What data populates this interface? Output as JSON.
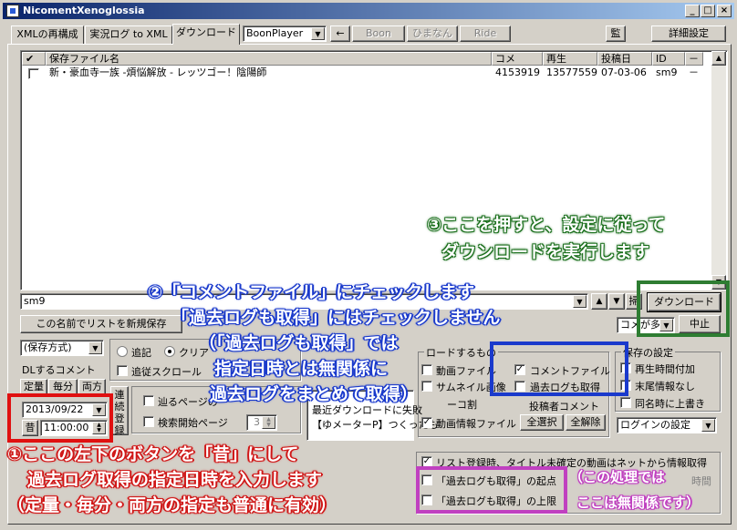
{
  "window": {
    "title": "NicomentXenoglossia",
    "minimize": "_",
    "maximize": "□",
    "close": "×"
  },
  "tabs": [
    {
      "label": "XMLの再構成"
    },
    {
      "label": "実況ログ to XML"
    },
    {
      "label": "ダウンロード"
    }
  ],
  "toolbar": {
    "player_select": "BoonPlayer",
    "back_arrow": "←",
    "boon": "Boon",
    "himanan": "ひまなん",
    "ride": "Ride",
    "kan": "監",
    "settings": "詳細設定"
  },
  "table": {
    "columns": [
      "✔",
      "保存ファイル名",
      "コメ",
      "再生",
      "投稿日",
      "ID",
      "－"
    ],
    "rows": [
      {
        "checked": "",
        "name": "新・豪血寺一族 -煩悩解放 - レッツゴー！陰陽師",
        "comments": "4153919",
        "views": "13577559",
        "date": "07-03-06",
        "id": "sm9",
        "dash": "－"
      }
    ]
  },
  "search": {
    "value": "sm9",
    "up": "▲",
    "down": "▼",
    "small_btn": "掃",
    "download_btn": "ダウンロード",
    "stop_btn": "中止",
    "new_list_btn": "この名前でリストを新規保存",
    "sort_combo": "コメが多い"
  },
  "save_method": {
    "combo": "(保存方式)",
    "dl_comment_label": "DLするコメント",
    "fixed": "定量",
    "per_min": "毎分",
    "both": "両方",
    "date": "2013/09/22",
    "mukashi": "昔",
    "time": "11:00:00",
    "renzoku": "連続登録"
  },
  "options": {
    "append": "追記",
    "clear": "クリア",
    "follow_scroll": "追従スクロール",
    "follow_pages": "辿るページの",
    "search_start_page": "検索開始ページ",
    "start_page_value": "3"
  },
  "mini_list": [
    "最近ダウンロードに失敗",
    "【ゆメーターP】つくったも"
  ],
  "download_targets": {
    "title": "ロードするもの",
    "video_file": "動画ファイル",
    "thumbnail": "サムネイル画像",
    "niconico": "ーコ割",
    "comment_file": "コメントファイル",
    "past_log": "過去ログも取得",
    "poster_comment": "投稿者コメント",
    "video_info": "動画情報ファイル",
    "select_all": "全選択",
    "deselect_all": "全解除"
  },
  "save_settings": {
    "title": "保存の設定",
    "add_play_time": "再生時間付加",
    "no_trailing_info": "末尾情報なし",
    "overwrite_same_name": "同名時に上書き",
    "login_combo": "ログインの設定"
  },
  "bottom": {
    "list_fetch": "リスト登録時、タイトル未確定の動画はネットから情報取得",
    "past_log_start": "「過去ログも取得」の起点",
    "past_log_limit": "「過去ログも取得」の上限",
    "time_suffix": "時間"
  },
  "annotations": {
    "step3": [
      "③ここを押すと、設定に従って",
      "ダウンロードを実行します"
    ],
    "step2": [
      "②「コメントファイル」にチェックします",
      "「過去ログも取得」にはチェックしません",
      "（「過去ログも取得」では",
      "指定日時とは無関係に",
      "過去ログをまとめて取得）"
    ],
    "step1": [
      "①ここの左下のボタンを「昔」にして",
      "過去ログ取得の指定日時を入力します",
      "（定量・毎分・両方の指定も普通に有効）"
    ],
    "note": [
      "（この処理では",
      "ここは無関係です）"
    ]
  },
  "colors": {
    "title_bar": "#0a246a",
    "green": "#2e7d32",
    "blue": "#1a3acc",
    "red": "#e01010",
    "magenta": "#c040c0"
  }
}
